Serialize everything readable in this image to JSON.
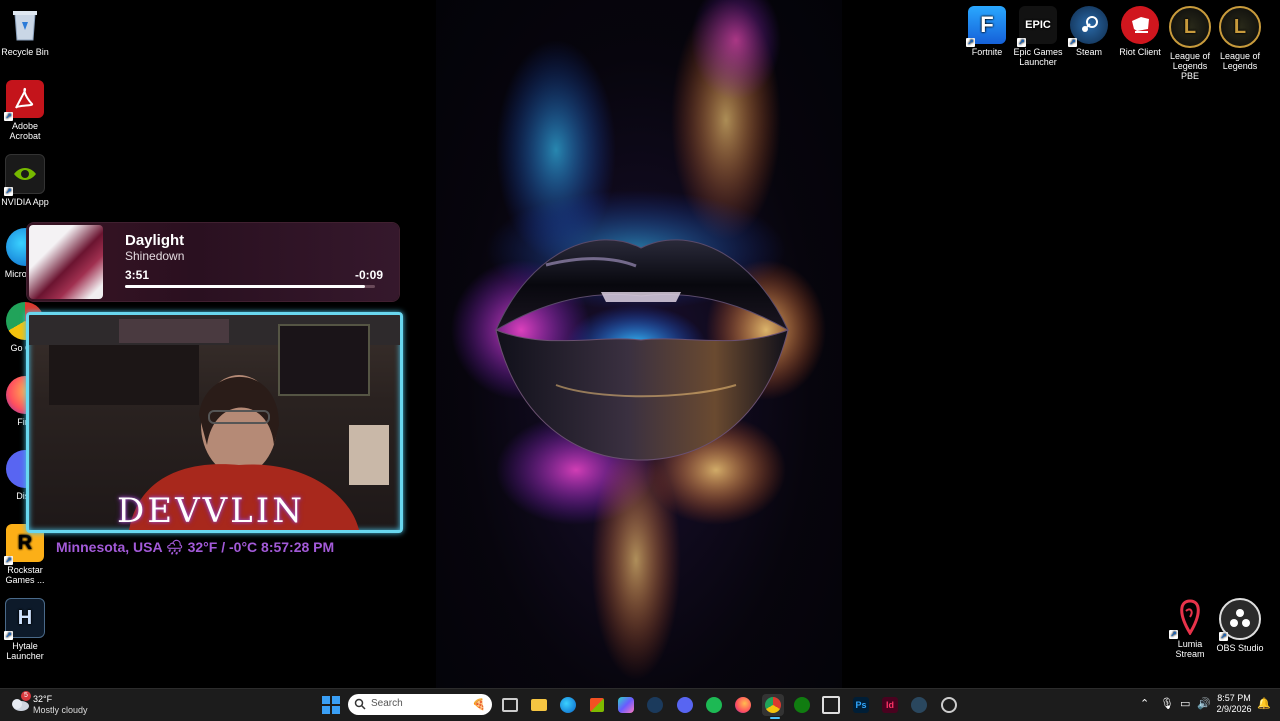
{
  "desktop": {
    "left_icons": [
      {
        "label": "Recycle Bin",
        "icon": "recycle-bin-icon"
      },
      {
        "label": "Adobe Acrobat",
        "icon": "acrobat-icon"
      },
      {
        "label": "NVIDIA App",
        "icon": "nvidia-icon"
      },
      {
        "label": "Micro Edg",
        "icon": "edge-icon"
      },
      {
        "label": "Go Chr",
        "icon": "chrome-icon"
      },
      {
        "label": "Fire",
        "icon": "firefox-icon"
      },
      {
        "label": "Disc",
        "icon": "discord-icon"
      },
      {
        "label": "Rockstar Games ...",
        "icon": "rockstar-icon"
      },
      {
        "label": "Hytale Launcher",
        "icon": "hytale-icon"
      }
    ],
    "top_right_icons": [
      {
        "label": "Fortnite",
        "icon": "fortnite-icon",
        "glyph": "F"
      },
      {
        "label": "Epic Games Launcher",
        "icon": "epic-games-icon",
        "glyph": "EPIC"
      },
      {
        "label": "Steam",
        "icon": "steam-icon",
        "glyph": ""
      },
      {
        "label": "Riot Client",
        "icon": "riot-client-icon",
        "glyph": ""
      },
      {
        "label": "League of Legends PBE",
        "icon": "league-pbe-icon",
        "glyph": "L"
      },
      {
        "label": "League of Legends",
        "icon": "league-icon",
        "glyph": "L"
      }
    ],
    "bottom_right_icons": [
      {
        "label": "Lumia Stream",
        "icon": "lumia-stream-icon"
      },
      {
        "label": "OBS Studio",
        "icon": "obs-studio-icon"
      }
    ]
  },
  "media_overlay": {
    "title": "Daylight",
    "artist": "Shinedown",
    "elapsed": "3:51",
    "remaining": "-0:09",
    "progress": 0.96
  },
  "stream_overlay": {
    "brand": "DEVVLIN",
    "status": "Minnesota, USA 🌧 32°F / -0°C  8:57:28 PM"
  },
  "taskbar": {
    "weather": {
      "temp": "32°F",
      "condition": "Mostly cloudy",
      "badge": "5"
    },
    "search_placeholder": "Search",
    "apps": [
      "task-view-icon",
      "file-explorer-icon",
      "edge-icon",
      "store-icon",
      "copilot-icon",
      "steam-icon",
      "discord-icon",
      "spotify-icon",
      "firefox-icon",
      "chrome-icon",
      "xbox-icon",
      "capture-icon",
      "photoshop-icon",
      "indesign-icon",
      "steam-alt-icon",
      "obs-icon"
    ],
    "clock": {
      "time": "8:57 PM",
      "date": "2/9/2026"
    }
  }
}
